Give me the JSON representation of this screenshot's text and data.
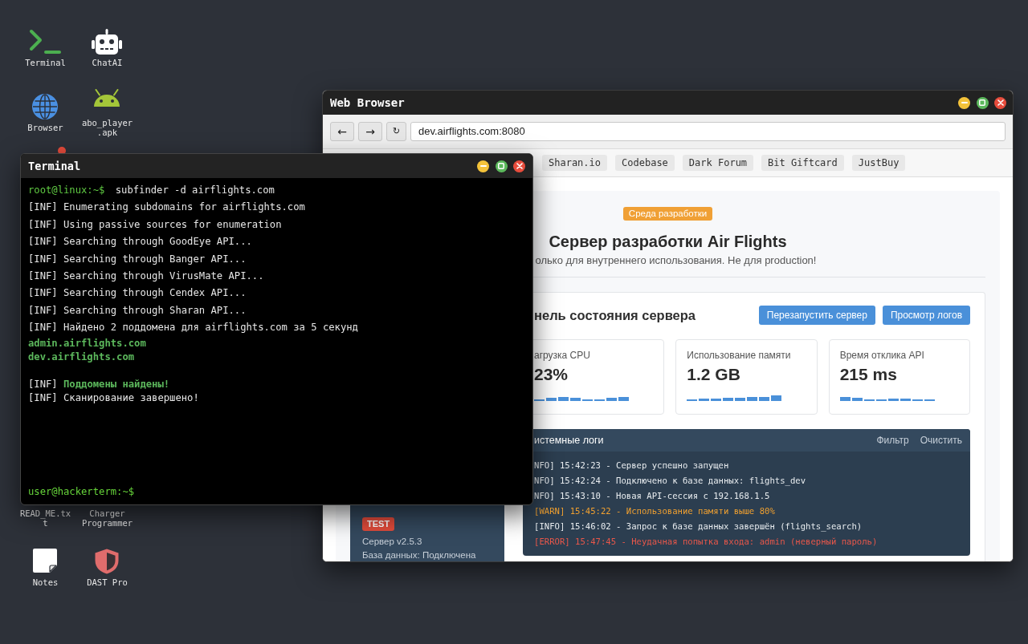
{
  "desktop": {
    "icons": [
      {
        "kind": "terminal",
        "label": "Terminal"
      },
      {
        "kind": "robot",
        "label": "ChatAI"
      },
      {
        "kind": "globe",
        "label": "Browser"
      },
      {
        "kind": "android",
        "label": "abo_player.apk"
      },
      {
        "kind": "covered",
        "label": "READ_ME.txt"
      },
      {
        "kind": "covered",
        "label": "Charger Programmer"
      },
      {
        "kind": "note",
        "label": "Notes"
      },
      {
        "kind": "shield",
        "label": "DAST Pro"
      }
    ]
  },
  "browser": {
    "title": "Web Browser",
    "nav_buttons": [
      "←",
      "→",
      "↻"
    ],
    "address": "dev.airflights.com:8080",
    "bookmarks": [
      "Sharan.io",
      "Codebase",
      "Dark Forum",
      "Bit Giftcard",
      "JustBuy"
    ],
    "page": {
      "badge": "Среда разработки",
      "title": "Сервер разработки Air Flights",
      "subtitle": "олько для внутреннего использования. Не для production!",
      "sidebar": {
        "badge": "TEST",
        "lines": [
          "Сервер v2.5.3",
          "База данных: Подключена"
        ]
      },
      "dashboard": {
        "heading": "нель состояния сервера",
        "buttons": [
          "Перезапустить сервер",
          "Просмотр логов"
        ],
        "metrics": [
          {
            "label": "агрузка CPU",
            "value": "23%"
          },
          {
            "label": "Использование памяти",
            "value": "1.2 GB"
          },
          {
            "label": "Время отклика API",
            "value": "215 ms"
          }
        ],
        "logs": {
          "title": "истемные логи",
          "actions": [
            "Фильтр",
            "Очистить"
          ],
          "entries": [
            {
              "kind": "info",
              "text": "NFO] 15:42:23 - Сервер успешно запущен"
            },
            {
              "kind": "info",
              "text": "NFO] 15:42:24 - Подключено к базе данных: flights_dev"
            },
            {
              "kind": "info",
              "text": "NFO] 15:43:10 - Новая API-сессия с 192.168.1.5"
            },
            {
              "kind": "warn",
              "text": "[WARN] 15:45:22 - Использование памяти выше 80%"
            },
            {
              "kind": "info",
              "text": "[INFO] 15:46:02 - Запрос к базе данных завершён (flights_search)"
            },
            {
              "kind": "error",
              "text": "[ERROR] 15:47:45 - Неудачная попытка входа: admin (неверный пароль)"
            }
          ]
        }
      }
    }
  },
  "terminal": {
    "title": "Terminal",
    "lines": [
      {
        "kind": "command",
        "prompt": "root@linux:~$",
        "text": "subfinder -d airflights.com"
      },
      {
        "kind": "log",
        "tag": "[INF]",
        "text": "Enumerating subdomains for airflights.com"
      },
      {
        "kind": "log",
        "tag": "[INF]",
        "text": "Using passive sources for enumeration"
      },
      {
        "kind": "log",
        "tag": "[INF]",
        "text": "Searching through GoodEye API..."
      },
      {
        "kind": "log",
        "tag": "[INF]",
        "text": "Searching through Banger API..."
      },
      {
        "kind": "log",
        "tag": "[INF]",
        "text": "Searching through VirusMate API..."
      },
      {
        "kind": "log",
        "tag": "[INF]",
        "text": "Searching through Cendex API..."
      },
      {
        "kind": "log",
        "tag": "[INF]",
        "text": "Searching through Sharan API..."
      },
      {
        "kind": "log",
        "tag": "[INF]",
        "text": "Найдено 2 поддомена для airflights.com за 5 секунд"
      },
      {
        "kind": "found",
        "text": "admin.airflights.com"
      },
      {
        "kind": "found",
        "text": "dev.airflights.com"
      },
      {
        "kind": "blank"
      },
      {
        "kind": "status",
        "tag": "[INF]",
        "text": "Поддомены найдены!",
        "success": true
      },
      {
        "kind": "status",
        "tag": "[INF]",
        "text": "Сканирование завершено!",
        "success": false
      }
    ],
    "prompt": "user@hackerterm:~$"
  }
}
